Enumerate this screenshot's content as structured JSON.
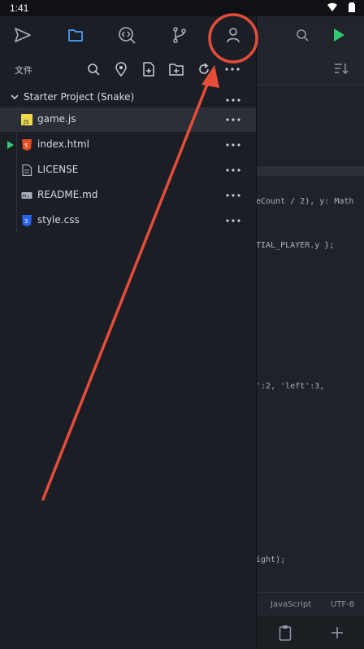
{
  "status": {
    "time": "1:41"
  },
  "drawer": {
    "header_label": "文件",
    "project_name": "Starter Project (Snake)",
    "files": [
      {
        "name": "game.js",
        "type": "js",
        "selected": true
      },
      {
        "name": "index.html",
        "type": "html",
        "selected": false,
        "running": true
      },
      {
        "name": "LICENSE",
        "type": "text",
        "selected": false
      },
      {
        "name": "README.md",
        "type": "markdown",
        "selected": false
      },
      {
        "name": "style.css",
        "type": "css",
        "selected": false
      }
    ],
    "more_label": "•••"
  },
  "editor": {
    "code_lines": [
      "eCount / 2), y: Math",
      "TIAL_PLAYER.y };",
      "':2, 'left':3,",
      "ight);"
    ],
    "footer_language": "JavaScript",
    "footer_encoding": "UTF-8"
  },
  "colors": {
    "accent_blue": "#4aa3ff",
    "play_green": "#2ecc71",
    "annotation_red": "#e54d3a",
    "js_yellow": "#f0db4f",
    "html_orange": "#e44d26",
    "css_blue": "#2965f1"
  }
}
